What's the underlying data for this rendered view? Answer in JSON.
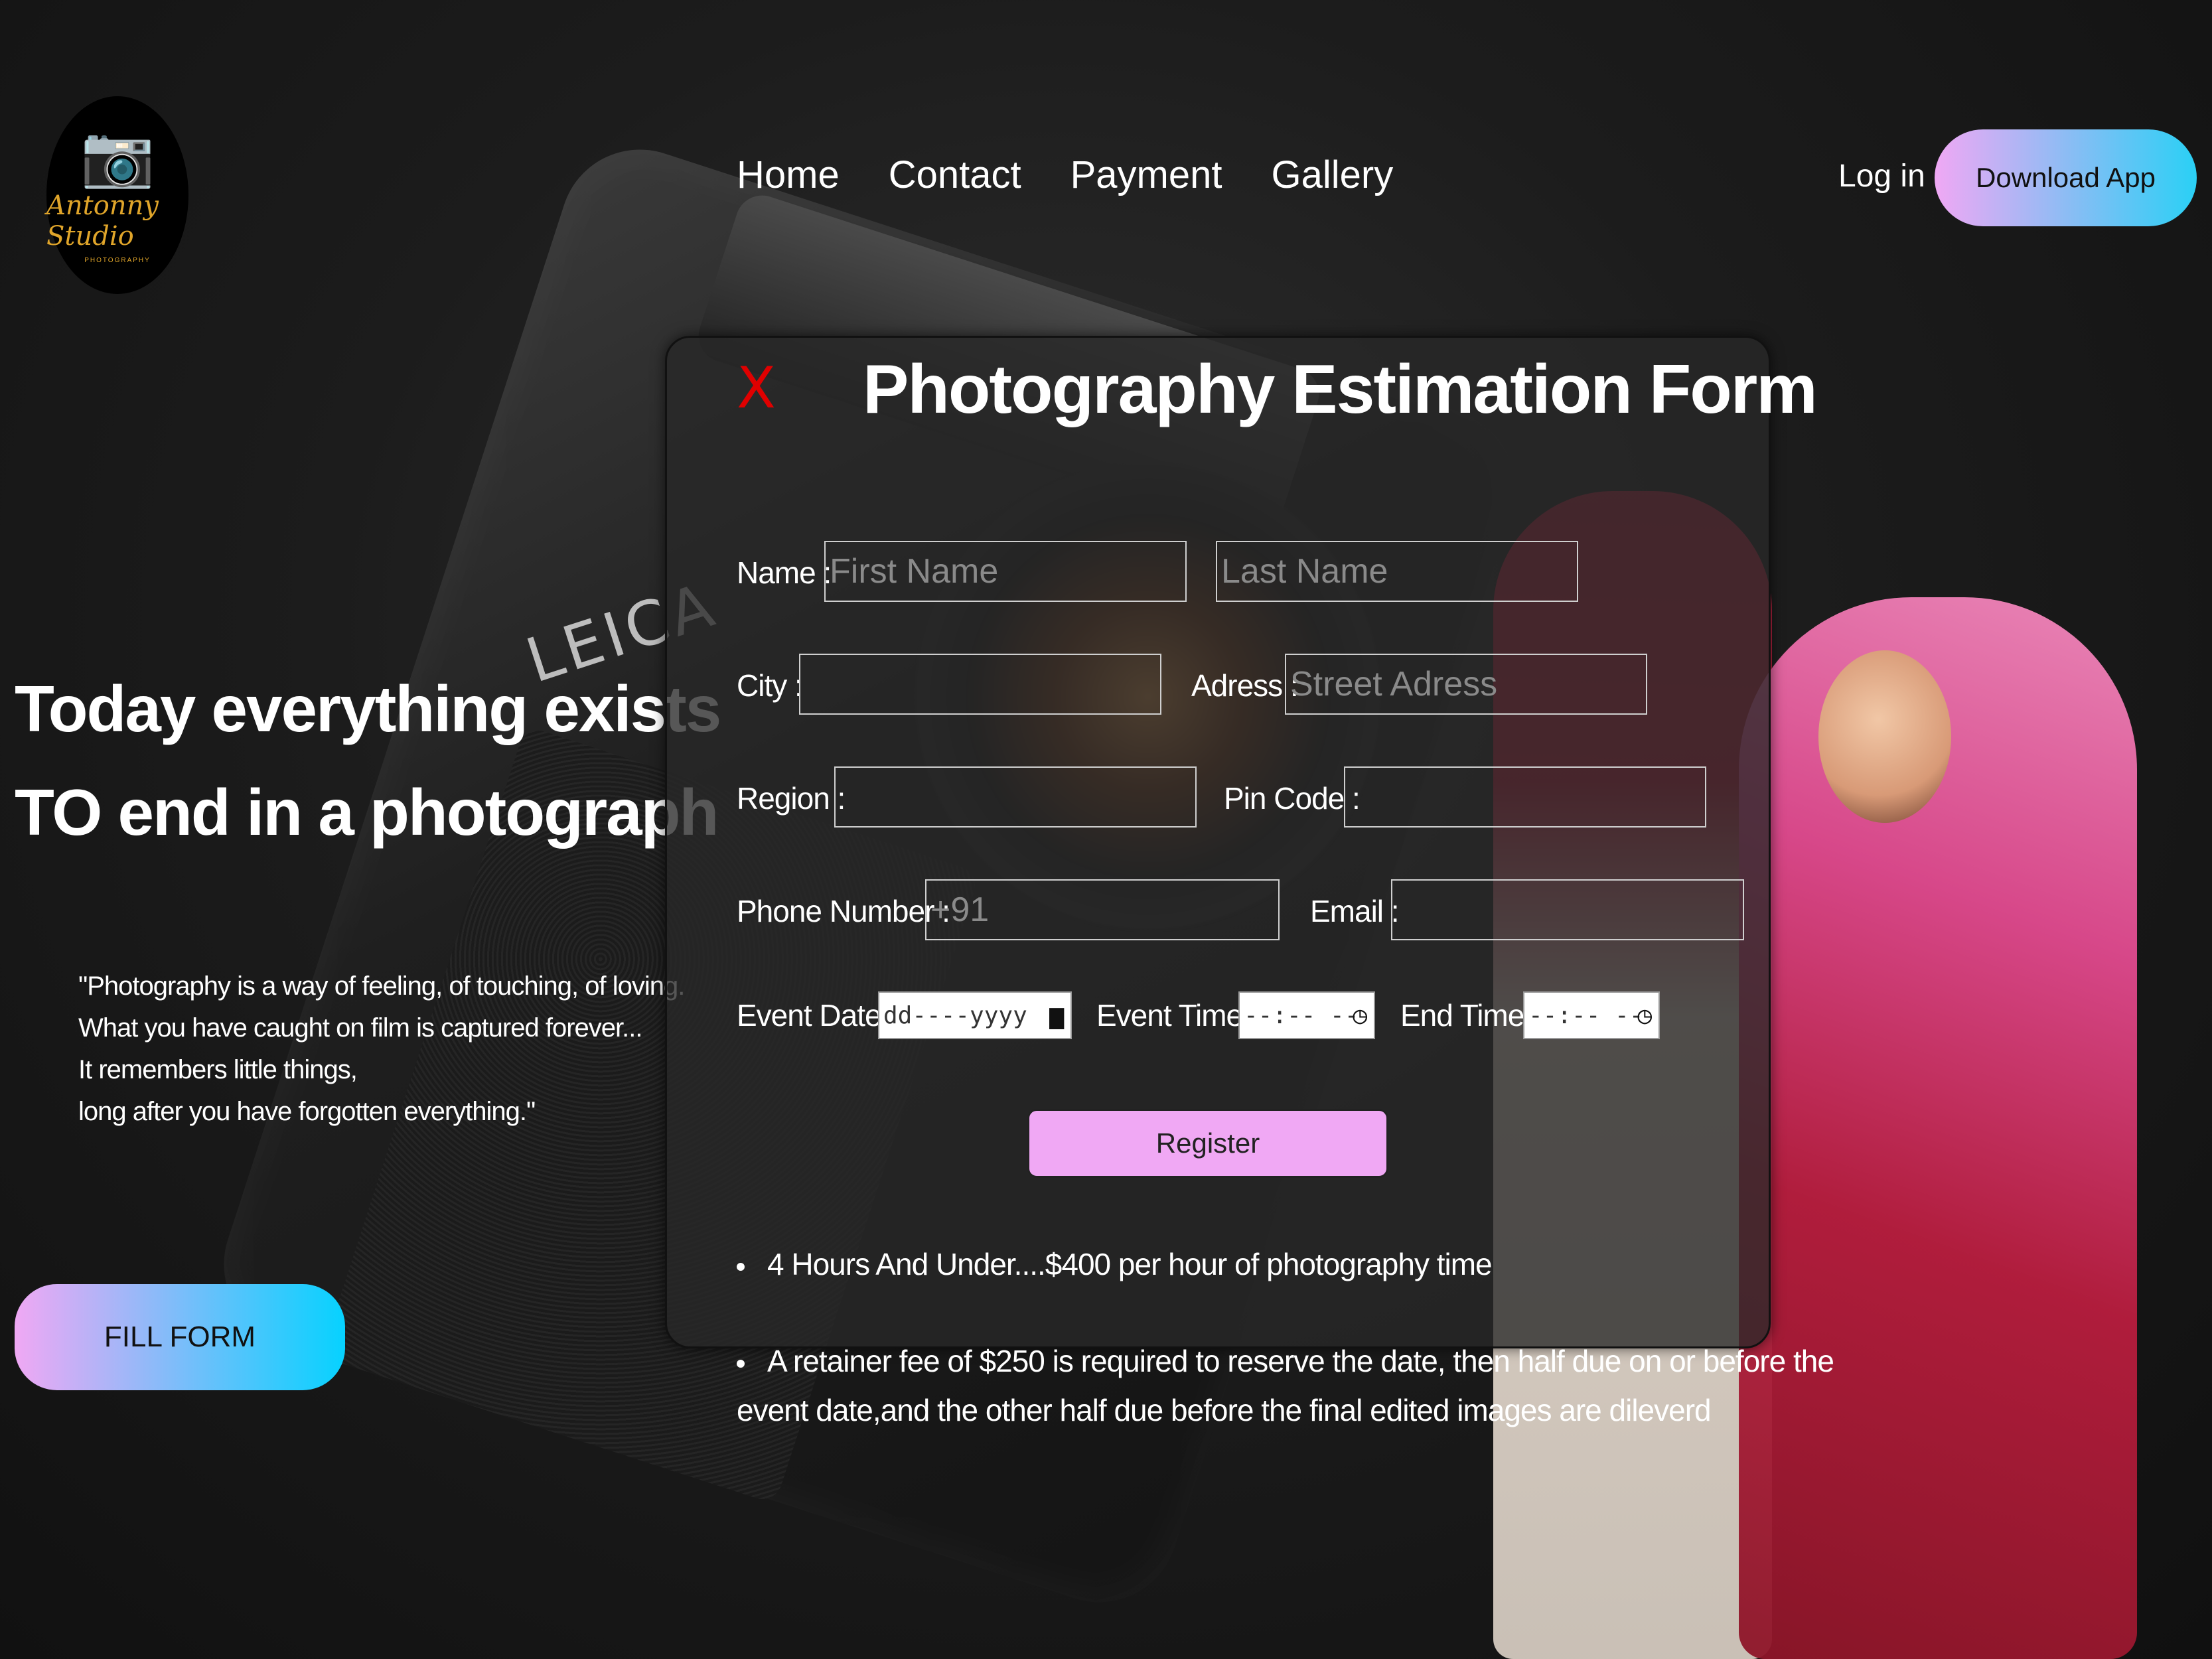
{
  "brand": {
    "logo_name": "Antonny Studio",
    "logo_sub": "PHOTOGRAPHY",
    "logo_icon": "camera-hands-icon"
  },
  "nav": {
    "items": [
      "Home",
      "Contact",
      "Payment",
      "Gallery"
    ],
    "login": "Log in",
    "download": "Download App"
  },
  "hero": {
    "title_line1": "Today everything exists",
    "title_line2": "TO end in a photograph",
    "quote_lines": [
      "\"Photography is a way of feeling, of touching, of loving.",
      "What you have caught on film is captured forever...",
      "It remembers little things,",
      "long after you have forgotten everything.\""
    ],
    "fill_form": "FILL FORM",
    "camera_brand_text": "LEICA"
  },
  "form": {
    "close": "X",
    "title": "Photography Estimation Form",
    "name_label": "Name :",
    "first_name_placeholder": "First Name",
    "last_name_placeholder": "Last Name",
    "city_label": "City :",
    "address_label": "Adress :",
    "address_placeholder": "Street Adress",
    "region_label": "Region :",
    "pin_label": "Pin Code :",
    "phone_label": "Phone Number :",
    "phone_placeholder": "+91",
    "email_label": "Email :",
    "event_date_label": "Event Date :",
    "event_date_value": "dd----yyyy",
    "event_time_label": "Event Time :",
    "event_time_value": "--:-- --",
    "end_time_label": "End Time :",
    "end_time_value": "--:-- --",
    "register": "Register",
    "bullet1": "4 Hours And Under....$400 per hour of photography time",
    "bullet2_line1": "A retainer fee of $250 is required to reserve the date, then half due on or before the",
    "bullet2_line2": "event date,and the other half due before the final edited images are dileverd"
  },
  "colors": {
    "accent_pink": "#f0a8f4",
    "accent_cyan": "#2ad0f5",
    "close_red": "#e00000",
    "logo_gold": "#e0a52a"
  }
}
